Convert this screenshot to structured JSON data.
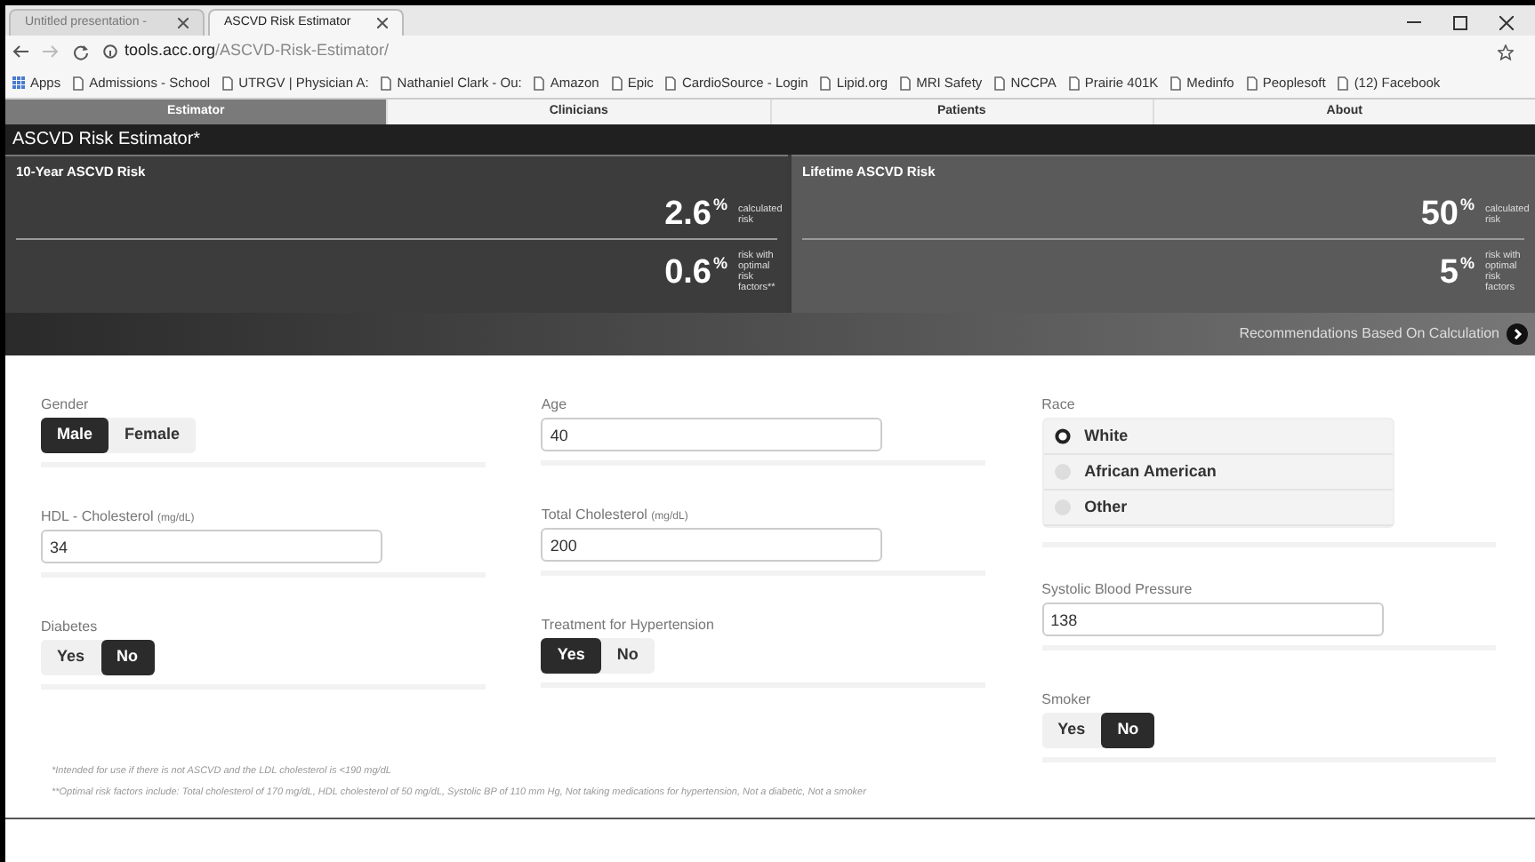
{
  "browser": {
    "tabs": [
      {
        "title": "Untitled presentation -",
        "selected": false
      },
      {
        "title": "ASCVD Risk Estimator",
        "selected": true
      }
    ],
    "address": {
      "host": "tools.acc.org",
      "path": "/ASCVD-Risk-Estimator/"
    },
    "bookmarks": [
      "Apps",
      "Admissions - School",
      "UTRGV | Physician A:",
      "Nathaniel Clark - Ou:",
      "Amazon",
      "Epic",
      "CardioSource - Login",
      "Lipid.org",
      "MRI Safety",
      "NCCPA",
      "Prairie 401K",
      "Medinfo",
      "Peoplesoft",
      "(12) Facebook"
    ]
  },
  "nav_tabs": [
    {
      "label": "Estimator",
      "selected": true
    },
    {
      "label": "Clinicians",
      "selected": false
    },
    {
      "label": "Patients",
      "selected": false
    },
    {
      "label": "About",
      "selected": false
    }
  ],
  "title": "ASCVD Risk Estimator*",
  "risk_panels": [
    {
      "title": "10-Year ASCVD Risk",
      "rows": [
        {
          "value": "2.6",
          "unit": "%",
          "note": "calculated risk"
        },
        {
          "value": "0.6",
          "unit": "%",
          "note": "risk with optimal risk factors**"
        }
      ]
    },
    {
      "title": "Lifetime ASCVD Risk",
      "rows": [
        {
          "value": "50",
          "unit": "%",
          "note": "calculated risk"
        },
        {
          "value": "5",
          "unit": "%",
          "note": "risk with optimal risk factors"
        }
      ]
    }
  ],
  "recommendation": "Recommendations Based On Calculation",
  "form_columns": [
    [
      {
        "kind": "segmented",
        "label": "Gender",
        "options": [
          {
            "label": "Male",
            "selected": true
          },
          {
            "label": "Female",
            "selected": false
          }
        ]
      },
      {
        "kind": "input",
        "label": "HDL - Cholesterol",
        "unit": "(mg/dL)",
        "value": "34"
      },
      {
        "kind": "segmented",
        "label": "Diabetes",
        "options": [
          {
            "label": "Yes",
            "selected": false
          },
          {
            "label": "No",
            "selected": true
          }
        ]
      }
    ],
    [
      {
        "kind": "input",
        "label": "Age",
        "value": "40"
      },
      {
        "kind": "input",
        "label": "Total Cholesterol",
        "unit": "(mg/dL)",
        "value": "200"
      },
      {
        "kind": "segmented",
        "label": "Treatment for Hypertension",
        "options": [
          {
            "label": "Yes",
            "selected": true
          },
          {
            "label": "No",
            "selected": false
          }
        ]
      }
    ],
    [
      {
        "kind": "radio",
        "label": "Race",
        "options": [
          {
            "label": "White",
            "selected": true
          },
          {
            "label": "African American",
            "selected": false
          },
          {
            "label": "Other",
            "selected": false
          }
        ]
      },
      {
        "kind": "input",
        "label": "Systolic Blood Pressure",
        "value": "138"
      },
      {
        "kind": "segmented",
        "label": "Smoker",
        "options": [
          {
            "label": "Yes",
            "selected": false
          },
          {
            "label": "No",
            "selected": true
          }
        ]
      }
    ]
  ],
  "footnotes": [
    "*Intended for use if there is not ASCVD and the LDL cholesterol is <190 mg/dL",
    "**Optimal risk factors include: Total cholesterol of 170 mg/dL, HDL cholesterol of 50 mg/dL, Systolic BP of 110 mm Hg, Not taking medications for hypertension, Not a diabetic, Not a smoker"
  ]
}
